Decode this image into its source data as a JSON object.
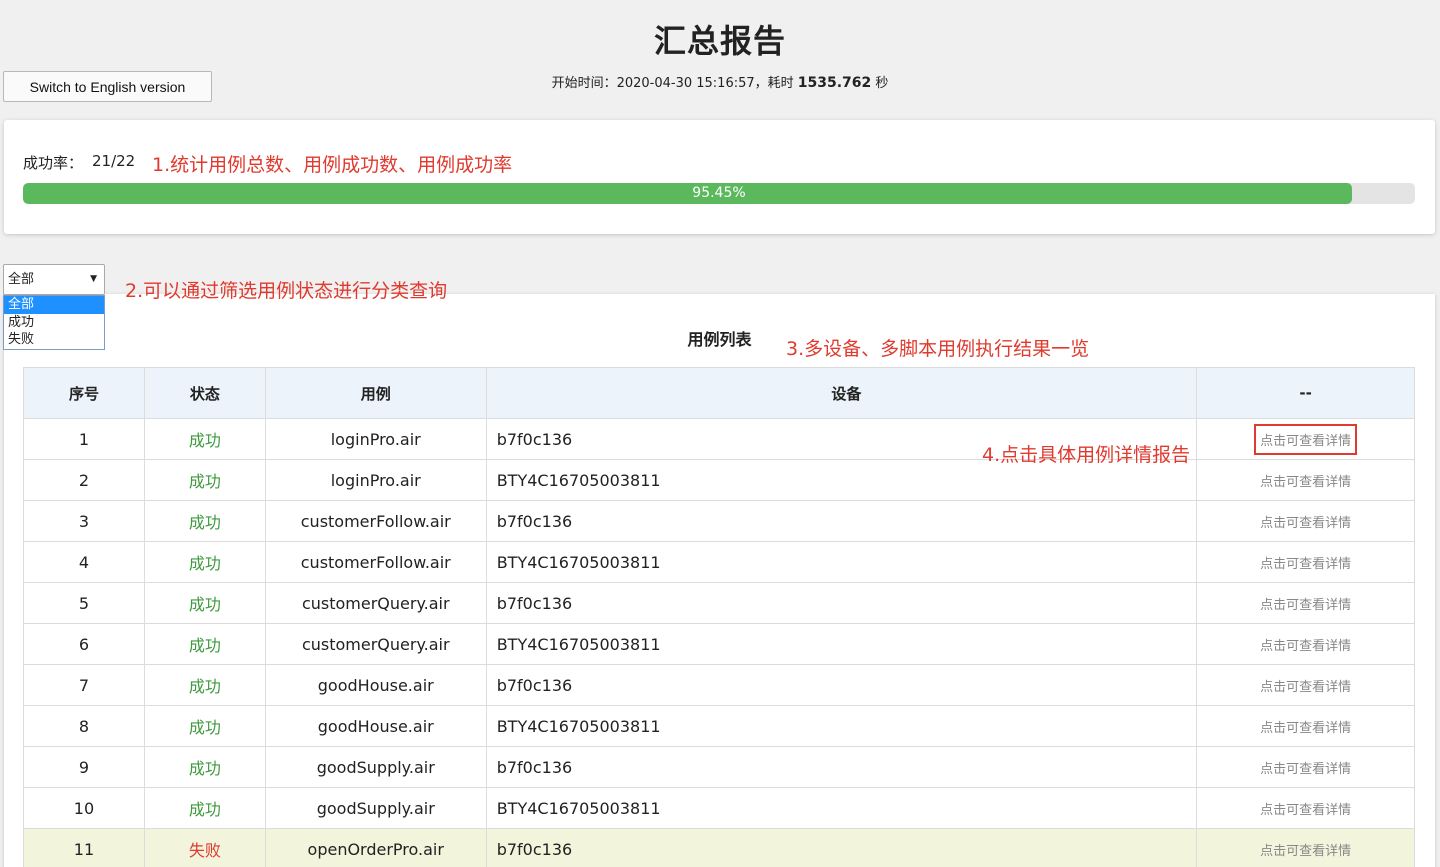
{
  "header": {
    "title": "汇总报告",
    "lang_button": "Switch to English version",
    "start_prefix": "开始时间：2020-04-30 15:16:57，耗时 ",
    "duration": "1535.762",
    "duration_unit": " 秒"
  },
  "summary": {
    "rate_label": "成功率：",
    "rate_value": "21/22",
    "progress_fraction": 0.9545,
    "progress_text": "95.45%",
    "annotation": "1.统计用例总数、用例成功数、用例成功率"
  },
  "filter": {
    "selected": "全部",
    "options": [
      "全部",
      "成功",
      "失败"
    ],
    "annotation": "2.可以通过筛选用例状态进行分类查询"
  },
  "list": {
    "title": "用例列表",
    "annotation": "3.多设备、多脚本用例执行结果一览",
    "detail_annotation": "4.点击具体用例详情报告",
    "headers": [
      "序号",
      "状态",
      "用例",
      "设备",
      "--"
    ],
    "detail_label": "点击可查看详情",
    "rows": [
      {
        "idx": "1",
        "status": "成功",
        "ok": true,
        "case": "loginPro.air",
        "device": "b7f0c136"
      },
      {
        "idx": "2",
        "status": "成功",
        "ok": true,
        "case": "loginPro.air",
        "device": "BTY4C16705003811"
      },
      {
        "idx": "3",
        "status": "成功",
        "ok": true,
        "case": "customerFollow.air",
        "device": "b7f0c136"
      },
      {
        "idx": "4",
        "status": "成功",
        "ok": true,
        "case": "customerFollow.air",
        "device": "BTY4C16705003811"
      },
      {
        "idx": "5",
        "status": "成功",
        "ok": true,
        "case": "customerQuery.air",
        "device": "b7f0c136"
      },
      {
        "idx": "6",
        "status": "成功",
        "ok": true,
        "case": "customerQuery.air",
        "device": "BTY4C16705003811"
      },
      {
        "idx": "7",
        "status": "成功",
        "ok": true,
        "case": "goodHouse.air",
        "device": "b7f0c136"
      },
      {
        "idx": "8",
        "status": "成功",
        "ok": true,
        "case": "goodHouse.air",
        "device": "BTY4C16705003811"
      },
      {
        "idx": "9",
        "status": "成功",
        "ok": true,
        "case": "goodSupply.air",
        "device": "b7f0c136"
      },
      {
        "idx": "10",
        "status": "成功",
        "ok": true,
        "case": "goodSupply.air",
        "device": "BTY4C16705003811"
      },
      {
        "idx": "11",
        "status": "失败",
        "ok": false,
        "case": "openOrderPro.air",
        "device": "b7f0c136"
      }
    ]
  },
  "colors": {
    "success": "#3d9a3d",
    "fail": "#e03a2e",
    "annotation": "#e03a2e",
    "progress": "#5cb85c",
    "header_bg": "#edf3fb",
    "fail_row_bg": "#f2f4dc"
  }
}
